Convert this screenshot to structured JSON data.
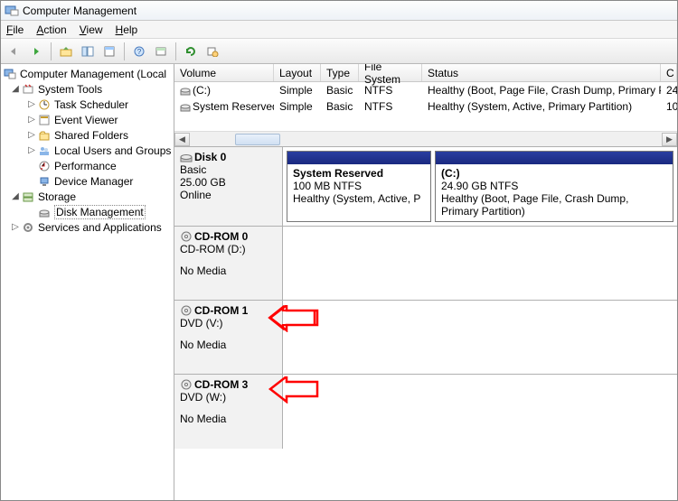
{
  "window": {
    "title": "Computer Management"
  },
  "menu": {
    "file": "File",
    "action": "Action",
    "view": "View",
    "help": "Help"
  },
  "tree": {
    "root": "Computer Management (Local",
    "systools": "System Tools",
    "systools_items": [
      "Task Scheduler",
      "Event Viewer",
      "Shared Folders",
      "Local Users and Groups",
      "Performance",
      "Device Manager"
    ],
    "storage": "Storage",
    "diskmgmt": "Disk Management",
    "services": "Services and Applications"
  },
  "volcols": {
    "volume": "Volume",
    "layout": "Layout",
    "type": "Type",
    "fs": "File System",
    "status": "Status",
    "cap": "C"
  },
  "volumes": [
    {
      "name": "(C:)",
      "layout": "Simple",
      "type": "Basic",
      "fs": "NTFS",
      "status": "Healthy (Boot, Page File, Crash Dump, Primary Partition)",
      "cap": "24"
    },
    {
      "name": "System Reserved",
      "layout": "Simple",
      "type": "Basic",
      "fs": "NTFS",
      "status": "Healthy (System, Active, Primary Partition)",
      "cap": "10"
    }
  ],
  "disks": [
    {
      "name": "Disk 0",
      "type": "Basic",
      "size": "25.00 GB",
      "state": "Online",
      "parts": [
        {
          "title": "System Reserved",
          "line2": "100 MB NTFS",
          "line3": "Healthy (System, Active, P",
          "flex": "0 0 160px"
        },
        {
          "title": "(C:)",
          "line2": "24.90 GB NTFS",
          "line3": "Healthy (Boot, Page File, Crash Dump, Primary Partition)",
          "flex": "1"
        }
      ]
    },
    {
      "name": "CD-ROM 0",
      "sub": "CD-ROM (D:)",
      "state": "No Media"
    },
    {
      "name": "CD-ROM 1",
      "sub": "DVD (V:)",
      "state": "No Media"
    },
    {
      "name": "CD-ROM 3",
      "sub": "DVD (W:)",
      "state": "No Media"
    }
  ]
}
